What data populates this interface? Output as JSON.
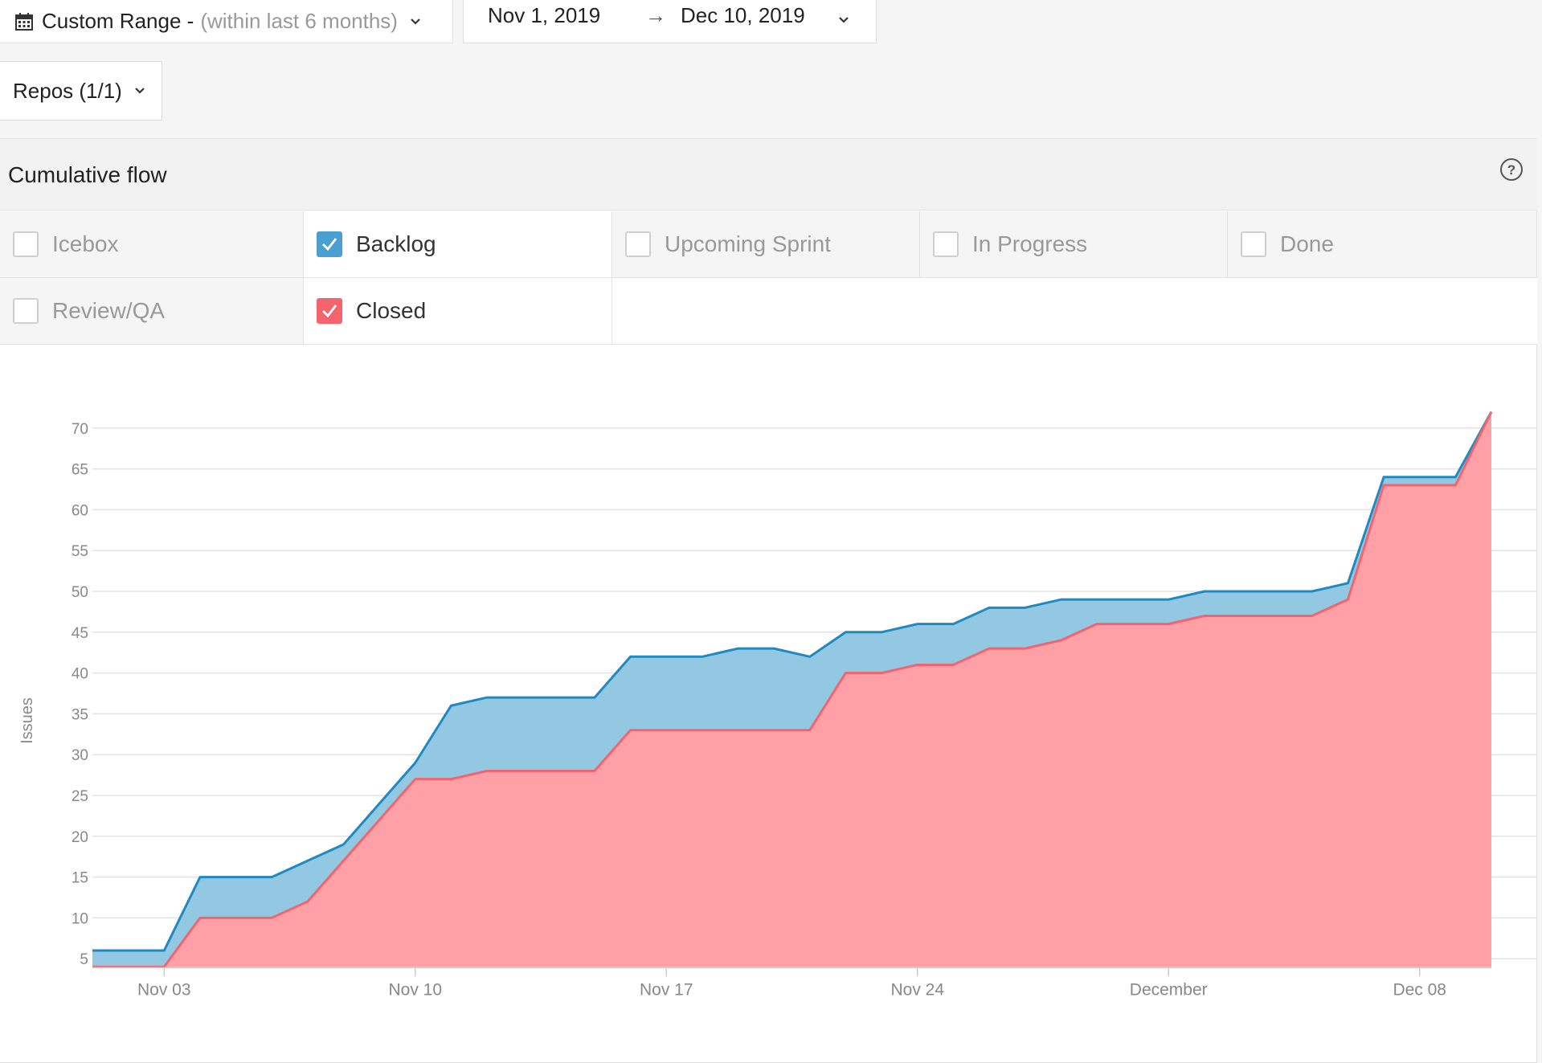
{
  "date_range": {
    "preset_label": "Custom Range -",
    "preset_hint": "(within last 6 months)",
    "start": "Nov 1, 2019",
    "arrow": "→",
    "end": "Dec 10, 2019"
  },
  "repos_label": "Repos (1/1)",
  "panel_title": "Cumulative flow",
  "pipelines": [
    {
      "label": "Icebox",
      "checked": false
    },
    {
      "label": "Backlog",
      "checked": true,
      "color": "#4a9fd0"
    },
    {
      "label": "Upcoming Sprint",
      "checked": false
    },
    {
      "label": "In Progress",
      "checked": false
    },
    {
      "label": "Done",
      "checked": false
    },
    {
      "label": "Review/QA",
      "checked": false
    },
    {
      "label": "Closed",
      "checked": true,
      "color": "#f4646e"
    }
  ],
  "chart_data": {
    "type": "area",
    "stacked": true,
    "ylabel": "Issues",
    "xlabel": "",
    "ylim": [
      4,
      76
    ],
    "yticks": [
      5,
      10,
      15,
      20,
      25,
      30,
      35,
      40,
      45,
      50,
      55,
      60,
      65,
      70
    ],
    "grid": true,
    "x_start": "2019-11-01",
    "xticks": [
      {
        "label": "Nov 03",
        "date": "2019-11-03"
      },
      {
        "label": "Nov 10",
        "date": "2019-11-10"
      },
      {
        "label": "Nov 17",
        "date": "2019-11-17"
      },
      {
        "label": "Nov 24",
        "date": "2019-11-24"
      },
      {
        "label": "December",
        "date": "2019-12-01"
      },
      {
        "label": "Dec 08",
        "date": "2019-12-08"
      }
    ],
    "x": [
      "2019-11-01",
      "2019-11-02",
      "2019-11-03",
      "2019-11-04",
      "2019-11-05",
      "2019-11-06",
      "2019-11-07",
      "2019-11-08",
      "2019-11-09",
      "2019-11-10",
      "2019-11-11",
      "2019-11-12",
      "2019-11-13",
      "2019-11-14",
      "2019-11-15",
      "2019-11-16",
      "2019-11-17",
      "2019-11-18",
      "2019-11-19",
      "2019-11-20",
      "2019-11-21",
      "2019-11-22",
      "2019-11-23",
      "2019-11-24",
      "2019-11-25",
      "2019-11-26",
      "2019-11-27",
      "2019-11-28",
      "2019-11-29",
      "2019-11-30",
      "2019-12-01",
      "2019-12-02",
      "2019-12-03",
      "2019-12-04",
      "2019-12-05",
      "2019-12-06",
      "2019-12-07",
      "2019-12-08",
      "2019-12-09",
      "2019-12-10"
    ],
    "series": [
      {
        "name": "Closed",
        "color": "#f4646e",
        "fill": "#ffa0a6",
        "values": [
          4,
          4,
          4,
          10,
          10,
          10,
          12,
          17,
          22,
          27,
          27,
          28,
          28,
          28,
          28,
          33,
          33,
          33,
          33,
          33,
          33,
          40,
          40,
          41,
          41,
          43,
          43,
          44,
          46,
          46,
          46,
          47,
          47,
          47,
          47,
          49,
          63,
          63,
          63,
          72
        ]
      },
      {
        "name": "Backlog",
        "color": "#1f8ac0",
        "fill": "#92c8e2",
        "values": [
          6,
          6,
          6,
          15,
          15,
          15,
          17,
          19,
          24,
          29,
          36,
          37,
          37,
          37,
          37,
          42,
          42,
          42,
          43,
          43,
          42,
          45,
          45,
          46,
          46,
          48,
          48,
          49,
          49,
          49,
          49,
          50,
          50,
          50,
          50,
          51,
          64,
          64,
          64,
          72
        ]
      }
    ]
  }
}
